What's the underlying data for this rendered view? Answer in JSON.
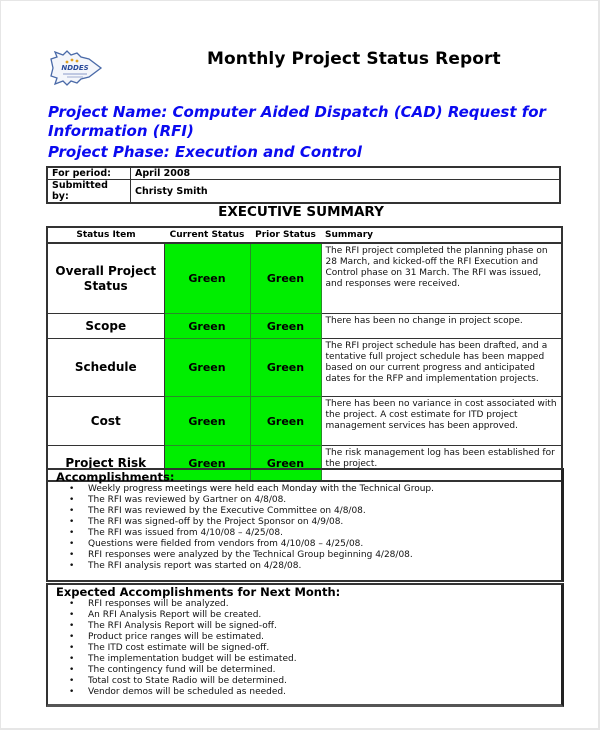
{
  "header": {
    "logo_text": "NDDES",
    "title": "Monthly Project Status Report"
  },
  "project": {
    "name": "Project Name: Computer Aided Dispatch (CAD) Request for Information (RFI)",
    "phase": "Project Phase: Execution and Control"
  },
  "meta": {
    "period_label": "For period:",
    "period_value": "April 2008",
    "submitted_label": "Submitted by:",
    "submitted_value": "Christy Smith"
  },
  "executive_summary": {
    "title": "EXECUTIVE SUMMARY",
    "columns": [
      "Status Item",
      "Current Status",
      "Prior Status",
      "Summary"
    ],
    "status_color": "#00ee00",
    "rows": [
      {
        "item": "Overall Project Status",
        "current": "Green",
        "prior": "Green",
        "summary": "The RFI project completed the planning phase on 28 March, and kicked-off the RFI Execution and Control phase on 31 March.  The RFI was issued, and responses were received."
      },
      {
        "item": "Scope",
        "current": "Green",
        "prior": "Green",
        "summary": "There has been no change in project scope."
      },
      {
        "item": "Schedule",
        "current": "Green",
        "prior": "Green",
        "summary": "The RFI project schedule has been drafted, and a tentative full project schedule has been mapped based on our current progress and anticipated dates for the RFP and implementation projects."
      },
      {
        "item": "Cost",
        "current": "Green",
        "prior": "Green",
        "summary": "There has been no variance in cost associated with the project.  A cost estimate for ITD project management services has been approved."
      },
      {
        "item": "Project Risk",
        "current": "Green",
        "prior": "Green",
        "summary": "The risk management log has been established for the project."
      }
    ]
  },
  "accomplishments": {
    "title": "Accomplishments:",
    "items": [
      "Weekly progress meetings were held each Monday with the Technical Group.",
      "The RFI was reviewed by Gartner on 4/8/08.",
      "The RFI was reviewed by the Executive Committee on 4/8/08.",
      "The RFI was signed-off by the Project Sponsor on 4/9/08.",
      "The RFI was issued from 4/10/08 – 4/25/08.",
      "Questions were fielded from vendors from 4/10/08 – 4/25/08.",
      "RFI responses were analyzed by the Technical Group beginning 4/28/08.",
      "The RFI analysis report was started on 4/28/08."
    ]
  },
  "expected": {
    "title": "Expected Accomplishments for Next Month:",
    "items": [
      "RFI responses will be analyzed.",
      "An RFI Analysis Report will be created.",
      "The RFI Analysis Report will be signed-off.",
      "Product price ranges will be estimated.",
      "The ITD cost estimate will be signed-off.",
      "The implementation budget will be estimated.",
      "The contingency fund will be determined.",
      "Total cost to State Radio will be determined.",
      "Vendor demos will be scheduled as needed."
    ]
  },
  "bullet_glyph": "•"
}
